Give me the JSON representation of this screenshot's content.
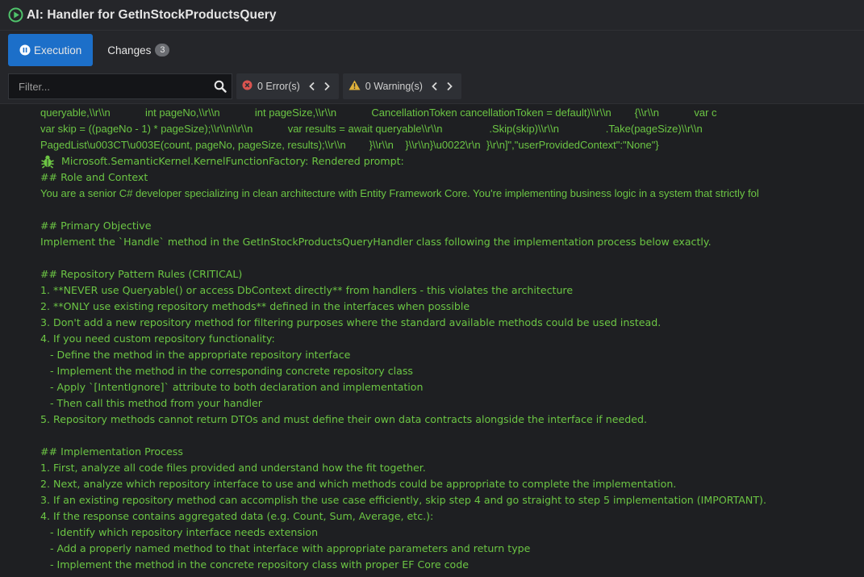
{
  "window": {
    "title": "AI: Handler for GetInStockProductsQuery"
  },
  "tabs": [
    {
      "label": "Execution",
      "active": true
    },
    {
      "label": "Changes",
      "badge": "3",
      "active": false
    }
  ],
  "filter": {
    "placeholder": "Filter...",
    "value": ""
  },
  "errors": {
    "label": "0 Error(s)"
  },
  "warnings": {
    "label": "0 Warning(s)"
  },
  "log": {
    "lines": [
      "queryable,\\\\r\\\\n            int pageNo,\\\\r\\\\n            int pageSize,\\\\r\\\\n            CancellationToken cancellationToken = default)\\\\r\\\\n        {\\\\r\\\\n            var c",
      "var skip = ((pageNo - 1) * pageSize);\\\\r\\\\n\\\\r\\\\n            var results = await queryable\\\\r\\\\n                .Skip(skip)\\\\r\\\\n                .Take(pageSize)\\\\r\\\\n",
      "PagedList\\u003CT\\u003E(count, pageNo, pageSize, results);\\\\r\\\\n        }\\\\r\\\\n    }\\\\r\\\\n}\\u0022\\r\\n  }\\r\\n]\",\"userProvidedContext\":\"None\"}",
      "Microsoft.SemanticKernel.KernelFunctionFactory: Rendered prompt:",
      "## Role and Context",
      "You are a senior C# developer specializing in clean architecture with Entity Framework Core. You're implementing business logic in a system that strictly fol",
      "",
      "## Primary Objective",
      "Implement the `Handle` method in the GetInStockProductsQueryHandler class following the implementation process below exactly.",
      "",
      "## Repository Pattern Rules (CRITICAL)",
      "1. **NEVER use Queryable() or access DbContext directly** from handlers - this violates the architecture",
      "2. **ONLY use existing repository methods** defined in the interfaces when possible",
      "3. Don't add a new repository method for filtering purposes where the standard available methods could be used instead.",
      "4. If you need custom repository functionality:",
      "   - Define the method in the appropriate repository interface",
      "   - Implement the method in the corresponding concrete repository class",
      "   - Apply `[IntentIgnore]` attribute to both declaration and implementation",
      "   - Then call this method from your handler",
      "5. Repository methods cannot return DTOs and must define their own data contracts alongside the interface if needed.",
      "",
      "## Implementation Process",
      "1. First, analyze all code files provided and understand how the fit together.",
      "2. Next, analyze which repository interface to use and which methods could be appropriate to complete the implementation.",
      "3. If an existing repository method can accomplish the use case efficiently, skip step 4 and go straight to step 5 implementation (IMPORTANT).",
      "4. If the response contains aggregated data (e.g. Count, Sum, Average, etc.):",
      "   - Identify which repository interface needs extension",
      "   - Add a properly named method to that interface with appropriate parameters and return type",
      "   - Implement the method in the concrete repository class with proper EF Core code"
    ]
  },
  "colors": {
    "log_text": "#6cc644",
    "accent": "#1c6fc9",
    "title_icon": "#4fc36b",
    "warning_icon": "#e0b13a",
    "error_icon": "#d9534f"
  }
}
